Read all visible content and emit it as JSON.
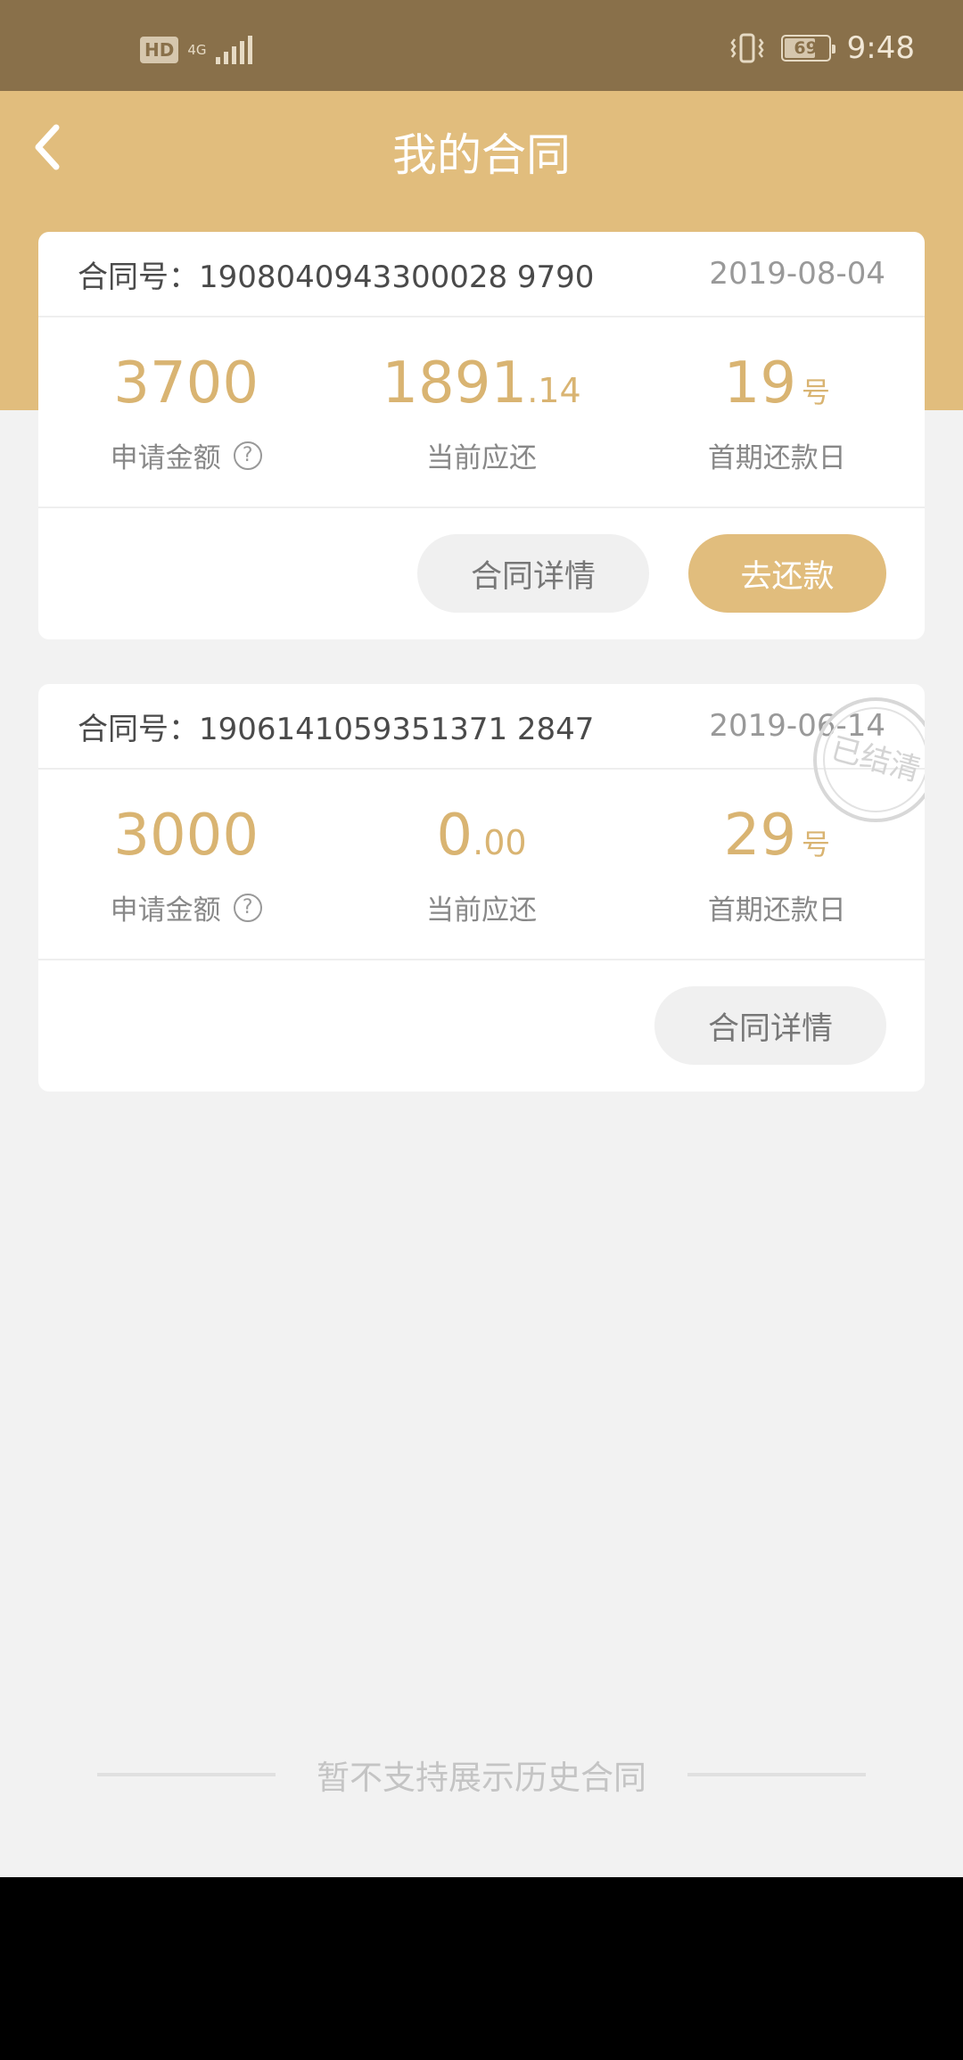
{
  "status_bar": {
    "hd": "HD",
    "network": "4G",
    "battery": "69",
    "time": "9:48"
  },
  "header": {
    "title": "我的合同"
  },
  "contracts": [
    {
      "contract_no": "合同号：1908040943300028 9790",
      "date": "2019-08-04",
      "amount": "3700",
      "amount_label": "申请金额",
      "current_int": "1891",
      "current_dec": ".14",
      "current_label": "当前应还",
      "first_day": "19",
      "first_day_suffix": "号",
      "first_day_label": "首期还款日",
      "detail_label": "合同详情",
      "repay_label": "去还款"
    },
    {
      "contract_no": "合同号：1906141059351371 2847",
      "date": "2019-06-14",
      "amount": "3000",
      "amount_label": "申请金额",
      "current_int": "0",
      "current_dec": ".00",
      "current_label": "当前应还",
      "first_day": "29",
      "first_day_suffix": "号",
      "first_day_label": "首期还款日",
      "detail_label": "合同详情",
      "stamp_text": "已结清"
    }
  ],
  "footer": {
    "note": "暂不支持展示历史合同"
  },
  "colors": {
    "accent": "#e1bd7d",
    "status_bar": "#89704a",
    "value_gold": "#d9b472"
  }
}
